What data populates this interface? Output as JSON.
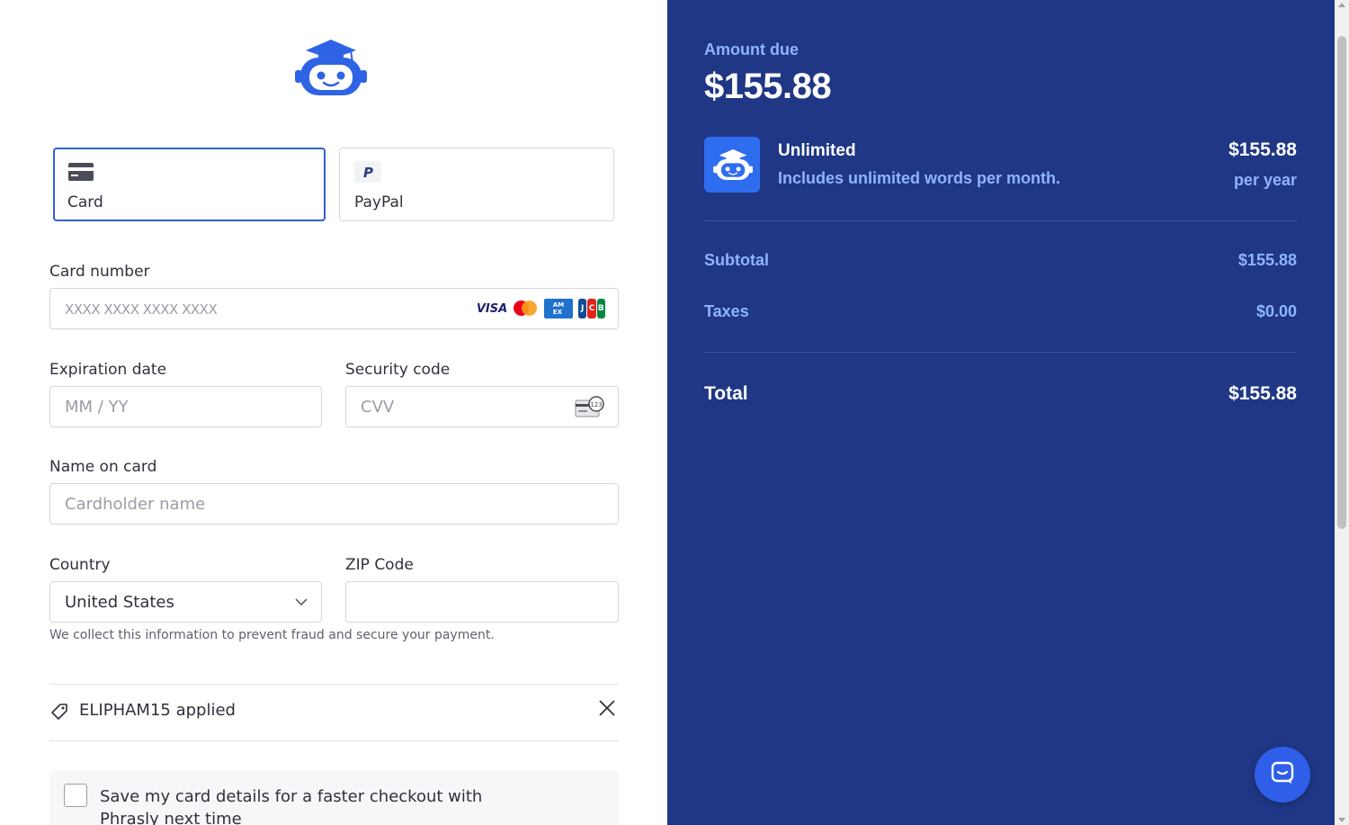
{
  "payment_methods": {
    "card_label": "Card",
    "paypal_label": "PayPal"
  },
  "card_number": {
    "label": "Card number",
    "placeholder": "XXXX XXXX XXXX XXXX",
    "brands": [
      "VISA",
      "mastercard",
      "amex",
      "JCB"
    ]
  },
  "expiration": {
    "label": "Expiration date",
    "placeholder": "MM / YY"
  },
  "security_code": {
    "label": "Security code",
    "placeholder": "CVV"
  },
  "name_on_card": {
    "label": "Name on card",
    "placeholder": "Cardholder name"
  },
  "country": {
    "label": "Country",
    "value": "United States"
  },
  "zip": {
    "label": "ZIP Code",
    "value": ""
  },
  "fraud_note": "We collect this information to prevent fraud and secure your payment.",
  "promo": {
    "text": "ELIPHAM15 applied"
  },
  "save_card": {
    "text": "Save my card details for a faster checkout with Phrasly next time",
    "checked": false
  },
  "summary": {
    "amount_label": "Amount due",
    "amount": "$155.88",
    "product_name": "Unlimited",
    "product_desc": "Includes unlimited words per month.",
    "product_price": "$155.88",
    "product_period": "per year",
    "subtotal_label": "Subtotal",
    "subtotal": "$155.88",
    "taxes_label": "Taxes",
    "taxes": "$0.00",
    "total_label": "Total",
    "total": "$155.88"
  },
  "colors": {
    "accent": "#2f5fd6",
    "summary_bg": "#1f3785",
    "summary_muted": "#8fb4ff"
  },
  "icons": [
    "robot-logo-icon",
    "card-icon",
    "paypal-icon",
    "cvc-card-icon",
    "chevron-down-icon",
    "tag-icon",
    "close-icon",
    "chat-icon"
  ]
}
